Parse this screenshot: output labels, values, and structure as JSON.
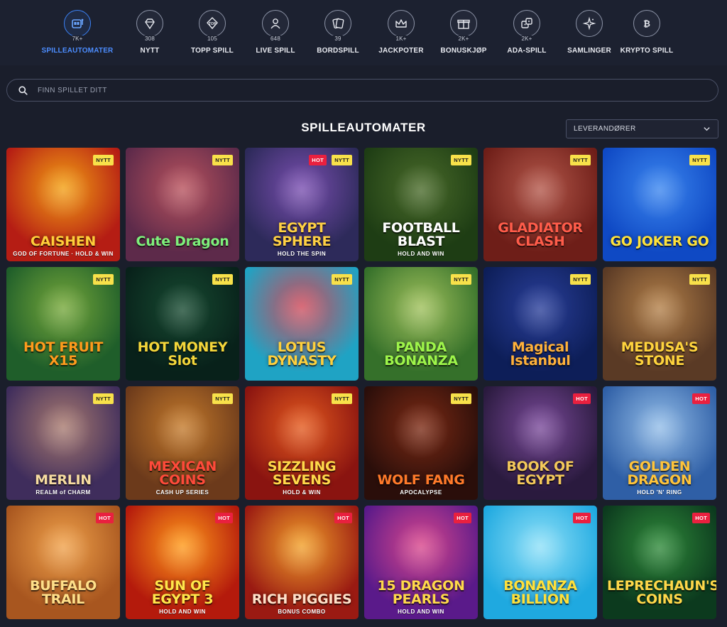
{
  "categories": [
    {
      "id": "slots",
      "label": "SPILLEAUTOMATER",
      "count": "7K+",
      "icon": "slot-machine-icon",
      "active": true
    },
    {
      "id": "new",
      "label": "NYTT",
      "count": "308",
      "icon": "diamond-icon",
      "active": false
    },
    {
      "id": "top",
      "label": "TOPP SPILL",
      "count": "105",
      "icon": "top-badge-icon",
      "active": false
    },
    {
      "id": "live",
      "label": "LIVE SPILL",
      "count": "648",
      "icon": "dealer-icon",
      "active": false
    },
    {
      "id": "table",
      "label": "BORDSPILL",
      "count": "39",
      "icon": "cards-icon",
      "active": false
    },
    {
      "id": "jackpot",
      "label": "JACKPOTER",
      "count": "1K+",
      "icon": "crown-icon",
      "active": false
    },
    {
      "id": "bonus",
      "label": "BONUSKJØP",
      "count": "2K+",
      "icon": "gift-icon",
      "active": false
    },
    {
      "id": "ada",
      "label": "ADA-SPILL",
      "count": "2K+",
      "icon": "dice-icon",
      "active": false
    },
    {
      "id": "collections",
      "label": "SAMLINGER",
      "count": "",
      "icon": "sparkle-icon",
      "active": false
    },
    {
      "id": "crypto",
      "label": "KRYPTO SPILL",
      "count": "",
      "icon": "bitcoin-icon",
      "active": false
    }
  ],
  "search": {
    "placeholder": "FINN SPILLET DITT"
  },
  "section": {
    "title": "SPILLEAUTOMATER",
    "providers_label": "LEVERANDØRER"
  },
  "badges": {
    "nytt": "NYTT",
    "hot": "HOT"
  },
  "games": [
    {
      "title": "CAISHEN",
      "subtitle": "GOD OF FORTUNE · HOLD & WIN",
      "badges": [
        "nytt"
      ],
      "bg": [
        "#b51d14",
        "#f3a013"
      ],
      "color": "#ffcf3a"
    },
    {
      "title": "Cute Dragon",
      "subtitle": "",
      "badges": [
        "nytt"
      ],
      "bg": [
        "#5d2a4a",
        "#b8525d"
      ],
      "color": "#7ef07b"
    },
    {
      "title": "EGYPT SPHERE",
      "subtitle": "HOLD THE SPIN",
      "badges": [
        "hot",
        "nytt"
      ],
      "bg": [
        "#2d2a5a",
        "#7a4fb1"
      ],
      "color": "#ffd043"
    },
    {
      "title": "FOOTBALL BLAST",
      "subtitle": "HOLD AND WIN",
      "badges": [
        "nytt"
      ],
      "bg": [
        "#1e3d14",
        "#4a6b2a"
      ],
      "color": "#ffffff"
    },
    {
      "title": "GLADIATOR CLASH",
      "subtitle": "",
      "badges": [
        "nytt"
      ],
      "bg": [
        "#6e1e18",
        "#b3574a"
      ],
      "color": "#ff5c4a"
    },
    {
      "title": "GO JOKER GO",
      "subtitle": "",
      "badges": [
        "nytt"
      ],
      "bg": [
        "#0f49c4",
        "#3b86ef"
      ],
      "color": "#ffe23a"
    },
    {
      "title": "HOT FRUIT X15",
      "subtitle": "",
      "badges": [
        "nytt"
      ],
      "bg": [
        "#1f5e2a",
        "#76a83a"
      ],
      "color": "#ff9a1c"
    },
    {
      "title": "HOT MONEY Slot",
      "subtitle": "",
      "badges": [
        "nytt"
      ],
      "bg": [
        "#08211a",
        "#174a31"
      ],
      "color": "#f4d63a"
    },
    {
      "title": "LOTUS DYNASTY",
      "subtitle": "",
      "badges": [
        "nytt"
      ],
      "bg": [
        "#1fa3c4",
        "#d04a5a"
      ],
      "color": "#ffd03d"
    },
    {
      "title": "PANDA BONANZA",
      "subtitle": "",
      "badges": [
        "nytt"
      ],
      "bg": [
        "#35702a",
        "#9fc05b"
      ],
      "color": "#9ef54a"
    },
    {
      "title": "Magical Istanbul",
      "subtitle": "",
      "badges": [
        "nytt"
      ],
      "bg": [
        "#0d1e58",
        "#2a3f9a"
      ],
      "color": "#ffb13a"
    },
    {
      "title": "MEDUSA'S STONE",
      "subtitle": "",
      "badges": [
        "nytt"
      ],
      "bg": [
        "#5a3a25",
        "#b38049"
      ],
      "color": "#ffd43d"
    },
    {
      "title": "MERLIN",
      "subtitle": "REALM of CHARM",
      "badges": [
        "nytt"
      ],
      "bg": [
        "#3f2d5c",
        "#a87a6f"
      ],
      "color": "#f6dca0"
    },
    {
      "title": "MEXICAN COINS",
      "subtitle": "CASH UP SERIES",
      "badges": [
        "nytt"
      ],
      "bg": [
        "#6c3a1b",
        "#c47a2b"
      ],
      "color": "#ff4a3a"
    },
    {
      "title": "SIZZLING SEVENS",
      "subtitle": "HOLD & WIN",
      "badges": [
        "nytt"
      ],
      "bg": [
        "#8a1410",
        "#e45a1e"
      ],
      "color": "#ffd94a"
    },
    {
      "title": "WOLF FANG",
      "subtitle": "APOCALYPSE",
      "badges": [
        "nytt"
      ],
      "bg": [
        "#2a0e0a",
        "#7c2a14"
      ],
      "color": "#ff7a2a"
    },
    {
      "title": "BOOK OF EGYPT",
      "subtitle": "",
      "badges": [
        "hot"
      ],
      "bg": [
        "#2a1a3e",
        "#7a4a9a"
      ],
      "color": "#f4c95a"
    },
    {
      "title": "GOLDEN DRAGON",
      "subtitle": "HOLD 'N' RING",
      "badges": [
        "hot"
      ],
      "bg": [
        "#2f5fa6",
        "#93bde8"
      ],
      "color": "#ffc43a"
    },
    {
      "title": "BUFFALO TRAIL",
      "subtitle": "",
      "badges": [
        "hot"
      ],
      "bg": [
        "#a8561f",
        "#f0a14a"
      ],
      "color": "#ffe08a"
    },
    {
      "title": "SUN OF EGYPT 3",
      "subtitle": "HOLD AND WIN",
      "badges": [
        "hot"
      ],
      "bg": [
        "#b41a0c",
        "#ff9a1a"
      ],
      "color": "#ffe64a"
    },
    {
      "title": "RICH PIGGIES",
      "subtitle": "BONUS COMBO",
      "badges": [
        "hot"
      ],
      "bg": [
        "#9a1a12",
        "#f2a02a"
      ],
      "color": "#ffe0c8"
    },
    {
      "title": "15 DRAGON PEARLS",
      "subtitle": "HOLD AND WIN",
      "badges": [
        "hot"
      ],
      "bg": [
        "#5a1a8a",
        "#d9478c"
      ],
      "color": "#ffd94a"
    },
    {
      "title": "BONANZA BILLION",
      "subtitle": "",
      "badges": [
        "hot"
      ],
      "bg": [
        "#1fa9e0",
        "#8fe0f8"
      ],
      "color": "#ffe03a"
    },
    {
      "title": "LEPRECHAUN'S COINS",
      "subtitle": "",
      "badges": [
        "hot"
      ],
      "bg": [
        "#0c3a1e",
        "#2f8a3a"
      ],
      "color": "#ffd84a"
    }
  ],
  "colors": {
    "accent": "#3b82f6",
    "background": "#1a1e2b",
    "nytt_badge": "#f8e14a",
    "hot_badge": "#e9203f"
  }
}
